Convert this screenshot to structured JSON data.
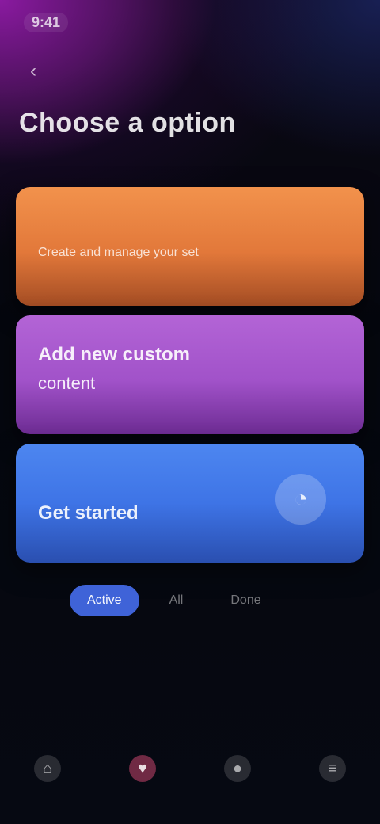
{
  "status": {
    "time": "9:41"
  },
  "header": {
    "back_icon": "chevron-left-icon",
    "back_glyph": "‹",
    "title": "Choose a option"
  },
  "cards": [
    {
      "title": "",
      "subtitle": "Create and manage your set",
      "color": "#e8823f"
    },
    {
      "title": "Add new custom",
      "subtitle": "content",
      "color": "#a85ad0"
    },
    {
      "title": "Get started",
      "subtitle": "",
      "icon": "chat-icon",
      "icon_glyph": "◔",
      "color": "#4a80ee"
    }
  ],
  "tabs": [
    {
      "label": "Active",
      "active": true
    },
    {
      "label": "All",
      "active": false
    },
    {
      "label": "Done",
      "active": false
    }
  ],
  "bottom_nav": [
    {
      "name": "home-icon",
      "glyph": "⌂",
      "active": false
    },
    {
      "name": "heart-icon",
      "glyph": "♥",
      "active": true
    },
    {
      "name": "profile-icon",
      "glyph": "●",
      "active": false
    },
    {
      "name": "menu-icon",
      "glyph": "≡",
      "active": false
    }
  ],
  "colors": {
    "accent": "#3f63d8",
    "orange_card": "#e8823f",
    "purple_card": "#a85ad0",
    "blue_card": "#4a80ee"
  }
}
